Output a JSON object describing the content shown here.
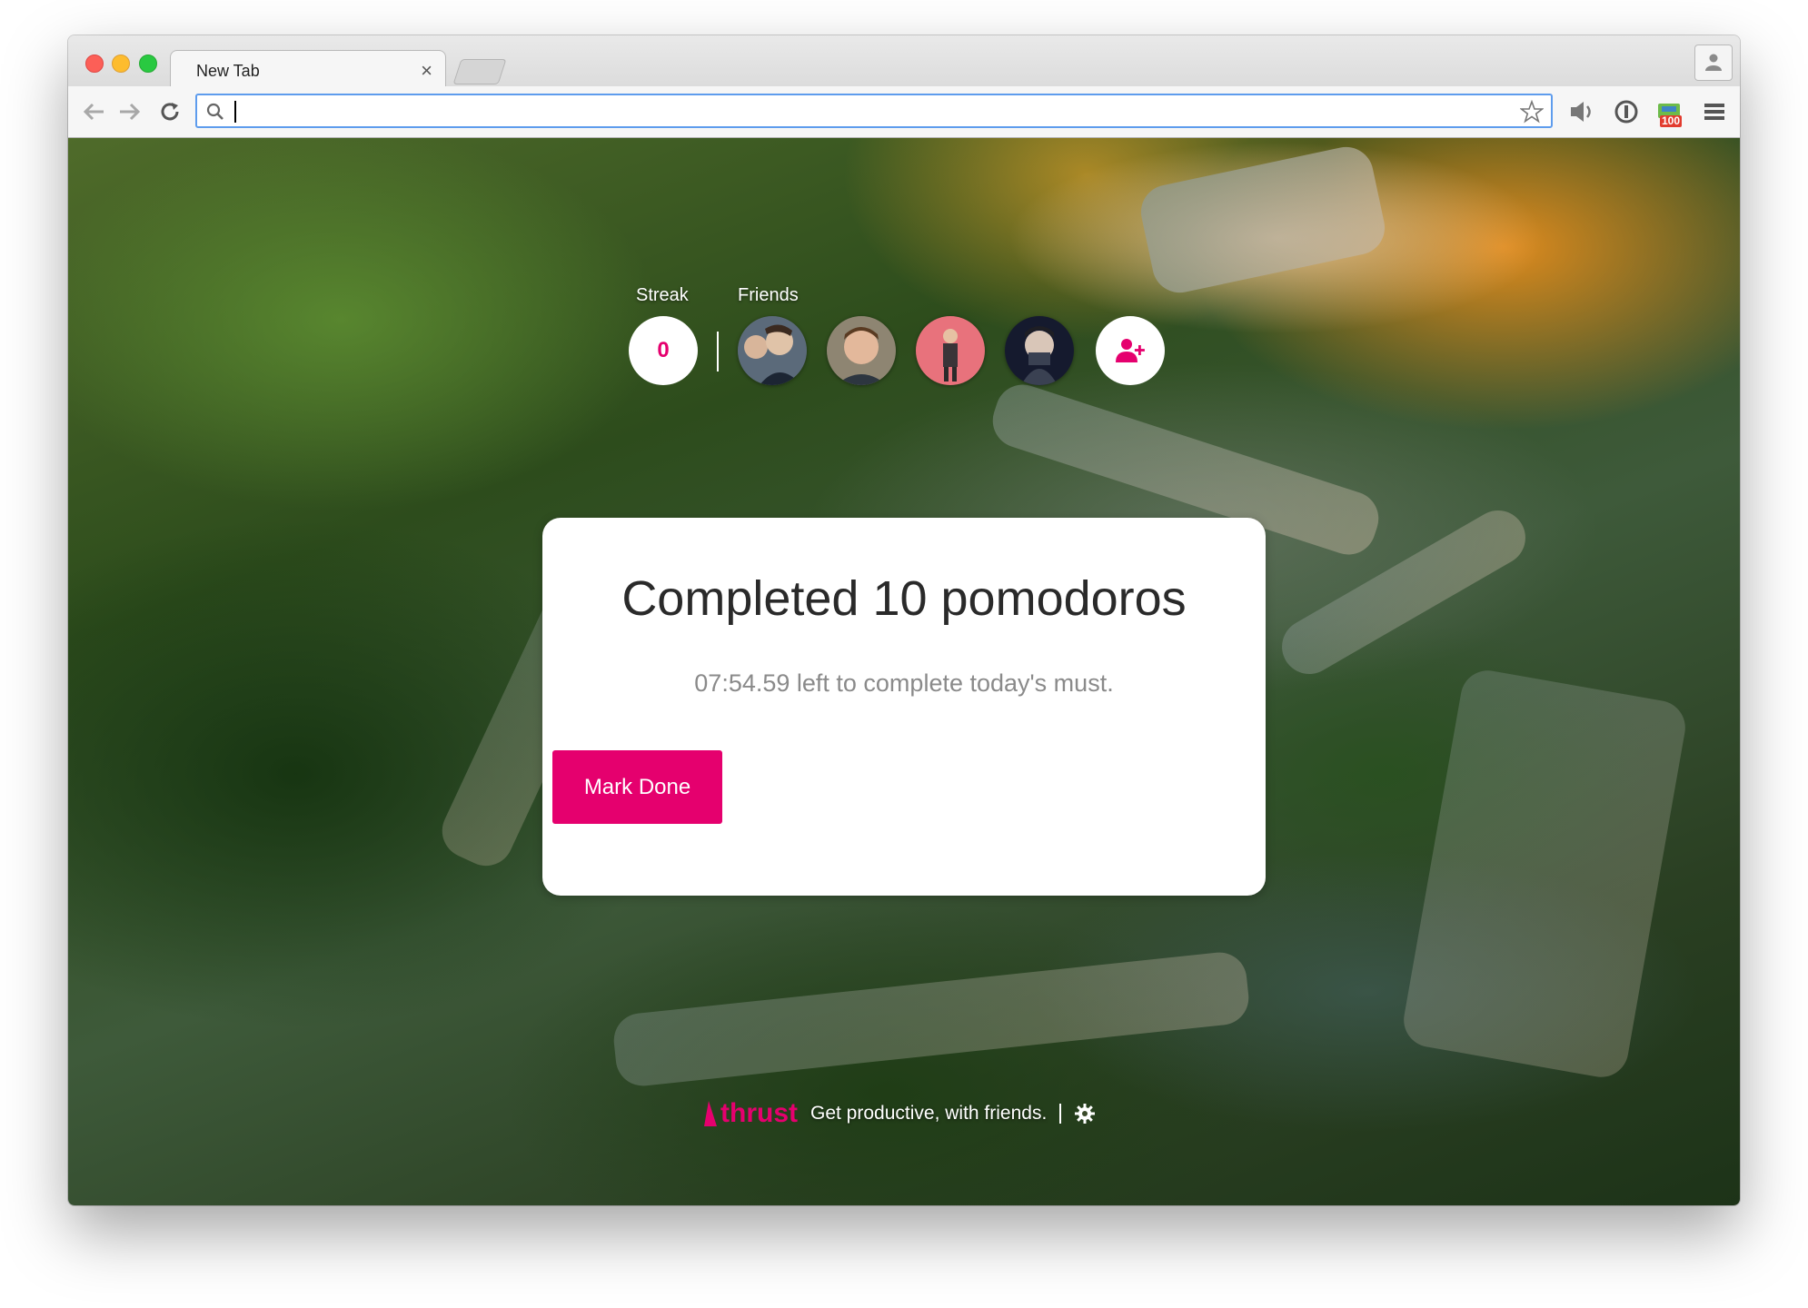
{
  "tab": {
    "title": "New Tab",
    "close_glyph": "×"
  },
  "toolbar": {
    "back_icon": "back-arrow-icon",
    "forward_icon": "forward-arrow-icon",
    "reload_icon": "reload-icon",
    "omnibox_value": "",
    "extension_badge": "100"
  },
  "header": {
    "streak_label": "Streak",
    "friends_label": "Friends",
    "streak_value": "0",
    "friends": [
      {
        "name": "friend-1"
      },
      {
        "name": "friend-2"
      },
      {
        "name": "friend-3"
      },
      {
        "name": "friend-4"
      }
    ]
  },
  "card": {
    "title": "Completed 10 pomodoros",
    "subtitle": "07:54.59 left to complete today's must.",
    "button": "Mark Done"
  },
  "footer": {
    "brand": "thrust",
    "tagline": "Get productive, with friends."
  },
  "colors": {
    "accent": "#e5006e",
    "omnibox_focus": "#5e9ced"
  }
}
